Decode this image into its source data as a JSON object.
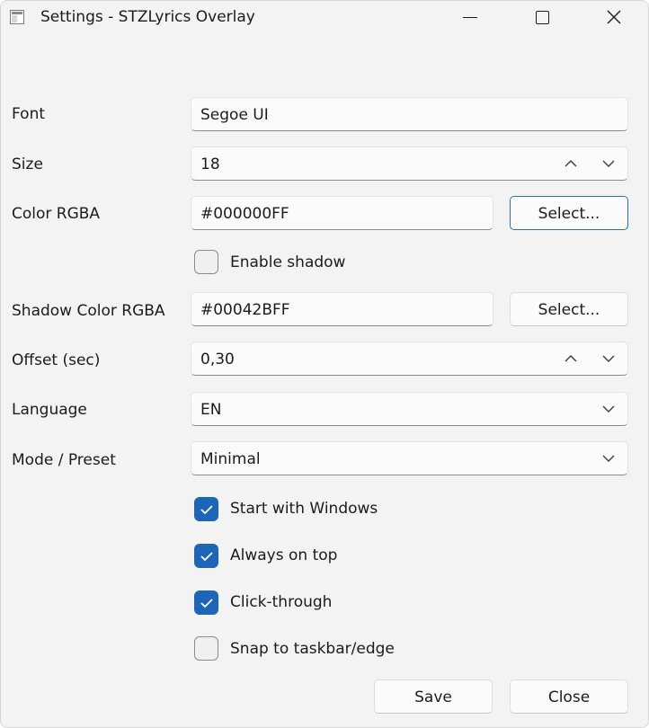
{
  "window": {
    "title": "Settings - STZLyrics Overlay",
    "accent_color": "#1d65b8"
  },
  "font": {
    "label": "Font",
    "value": "Segoe UI"
  },
  "size": {
    "label": "Size",
    "value": "18"
  },
  "color": {
    "label": "Color RGBA",
    "value": "#000000FF",
    "select_label": "Select..."
  },
  "shadow_toggle": {
    "label": "Enable shadow",
    "checked": false
  },
  "shadow_color": {
    "label": "Shadow Color RGBA",
    "value": "#00042BFF",
    "select_label": "Select..."
  },
  "offset": {
    "label": "Offset (sec)",
    "value": "0,30"
  },
  "language": {
    "label": "Language",
    "value": "EN"
  },
  "mode": {
    "label": "Mode / Preset",
    "value": "Minimal"
  },
  "options": [
    {
      "label": "Start with Windows",
      "checked": true
    },
    {
      "label": "Always on top",
      "checked": true
    },
    {
      "label": "Click-through",
      "checked": true
    },
    {
      "label": "Snap to taskbar/edge",
      "checked": false
    }
  ],
  "footer": {
    "save_label": "Save",
    "close_label": "Close"
  }
}
